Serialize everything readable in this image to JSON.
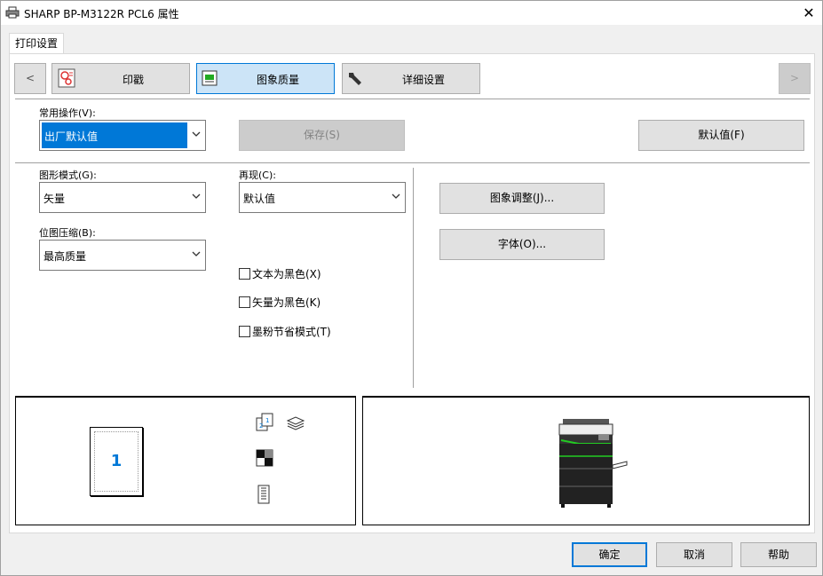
{
  "window": {
    "title": "SHARP BP-M3122R PCL6 属性"
  },
  "tabs": [
    {
      "label": "打印设置"
    }
  ],
  "nav": {
    "prev": "<",
    "next": ">",
    "buttons": [
      {
        "label": "印戳",
        "icon": "stamp-icon"
      },
      {
        "label": "图象质量",
        "icon": "image-quality-icon",
        "selected": true
      },
      {
        "label": "详细设置",
        "icon": "wrench-icon"
      }
    ]
  },
  "common_ops": {
    "label": "常用操作(V):",
    "value": "出厂默认值"
  },
  "buttons": {
    "save": "保存(S)",
    "defaults": "默认值(F)",
    "image_adjust": "图象调整(J)...",
    "fonts": "字体(O)..."
  },
  "graphics_mode": {
    "label": "图形模式(G):",
    "value": "矢量"
  },
  "reproduction": {
    "label": "再现(C):",
    "value": "默认值"
  },
  "bitmap_compression": {
    "label": "位图压缩(B):",
    "value": "最高质量"
  },
  "checkboxes": [
    {
      "label": "文本为黑色(X)",
      "checked": false
    },
    {
      "label": "矢量为黑色(K)",
      "checked": false
    },
    {
      "label": "墨粉节省模式(T)",
      "checked": false
    }
  ],
  "preview": {
    "page_number": "1"
  },
  "dialog_buttons": {
    "ok": "确定",
    "cancel": "取消",
    "help": "帮助"
  },
  "colors": {
    "accent": "#0078d7",
    "selected_nav": "#cce4f7"
  }
}
